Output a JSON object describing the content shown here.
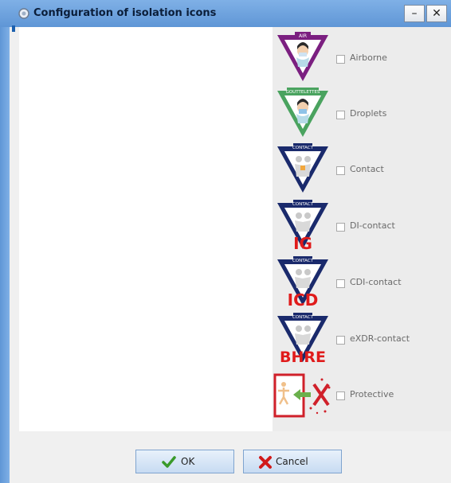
{
  "window": {
    "title": "Configuration of isolation icons",
    "minimize_label": "–",
    "close_label": "✕"
  },
  "isolation_items": [
    {
      "label": "Airborne",
      "icon": "airborne-isolation-icon",
      "banner": "AIR",
      "color": "#7b1f80",
      "checked": false
    },
    {
      "label": "Droplets",
      "icon": "droplets-isolation-icon",
      "banner": "GOUTTELETTES",
      "color": "#4aa35f",
      "checked": false
    },
    {
      "label": "Contact",
      "icon": "contact-isolation-icon",
      "banner": "CONTACT",
      "color": "#1a2a6c",
      "checked": false
    },
    {
      "label": "DI-contact",
      "icon": "di-contact-isolation-icon",
      "banner": "CONTACT",
      "overlay": "IG",
      "color": "#1a2a6c",
      "checked": false
    },
    {
      "label": "CDI-contact",
      "icon": "cdi-contact-isolation-icon",
      "banner": "CONTACT",
      "overlay": "ICD",
      "color": "#1a2a6c",
      "checked": false
    },
    {
      "label": "eXDR-contact",
      "icon": "exdr-contact-isolation-icon",
      "banner": "CONTACT",
      "overlay": "BHRE",
      "color": "#1a2a6c",
      "checked": false
    },
    {
      "label": "Protective",
      "icon": "protective-isolation-icon",
      "color": "#d0202a",
      "checked": false
    }
  ],
  "footer": {
    "ok_label": "OK",
    "cancel_label": "Cancel"
  },
  "colors": {
    "title_bar": "#6fa3df",
    "overlay_red": "#e01b1b",
    "ok_check": "#3a9a2a",
    "cancel_x": "#d11a1a"
  }
}
